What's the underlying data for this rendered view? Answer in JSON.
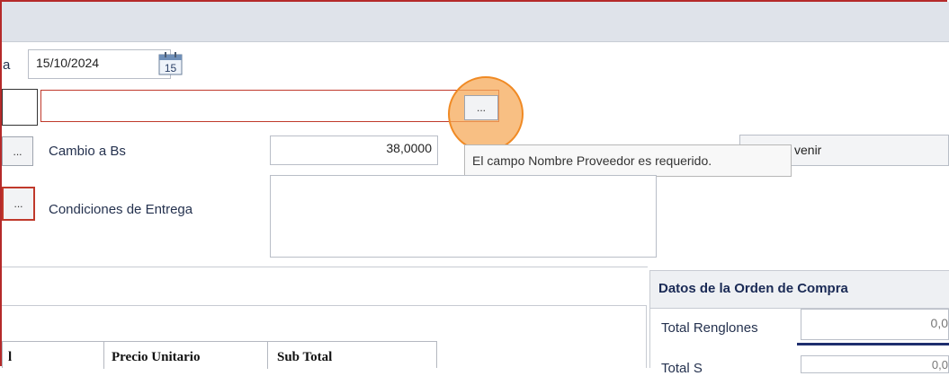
{
  "form": {
    "date_label_fragment": "a",
    "date_value": "15/10/2024",
    "calendar_icon_day": "15",
    "provider_name_value": "",
    "ellipsis": "...",
    "exchange_label": "Cambio a Bs",
    "exchange_value": "38,0000",
    "delivery_label": "Condiciones de Entrega",
    "delivery_value": "",
    "right_button_fragment": "venir"
  },
  "tooltip": {
    "text": "El campo Nombre Proveedor es requerido."
  },
  "order_panel": {
    "title": "Datos de la Orden de Compra",
    "total_lines_label": "Total Renglones",
    "total_lines_value": "0,0",
    "second_label_fragment": "Total S",
    "second_value_fragment": "0,0"
  },
  "table": {
    "columns": [
      "l",
      "Precio Unitario",
      "Sub Total"
    ]
  },
  "colors": {
    "error_border": "#c0392b",
    "highlight": "#f08a24",
    "accent_navy": "#1a2a55"
  },
  "icons": [
    "calendar-icon",
    "ellipsis-icon"
  ]
}
